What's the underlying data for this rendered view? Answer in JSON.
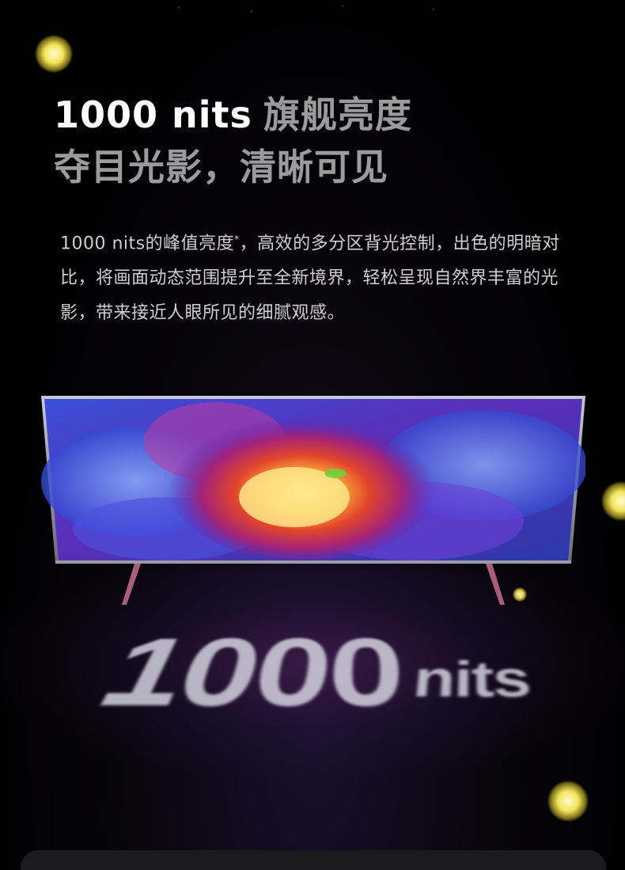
{
  "headline": {
    "line1_number": "1000 nits",
    "line1_text": "旗舰亮度",
    "line2": "夺目光影，清晰可见"
  },
  "description": {
    "lead": "1000 nits的峰值亮度",
    "footnote_mark": "*",
    "body": "，高效的多分区背光控制，出色的明暗对比，将画面动态范围提升至全新境界，轻松呈现自然界丰富的光影，带来接近人眼所见的细腻观感。"
  },
  "hero": {
    "big_number": "1000",
    "big_unit": "nits"
  },
  "colors": {
    "background": "#000000",
    "headline_white": "#ffffff",
    "headline_gray": "#9b9b9b",
    "body_text": "#cfcfcf",
    "orb": "#f2e35a"
  }
}
